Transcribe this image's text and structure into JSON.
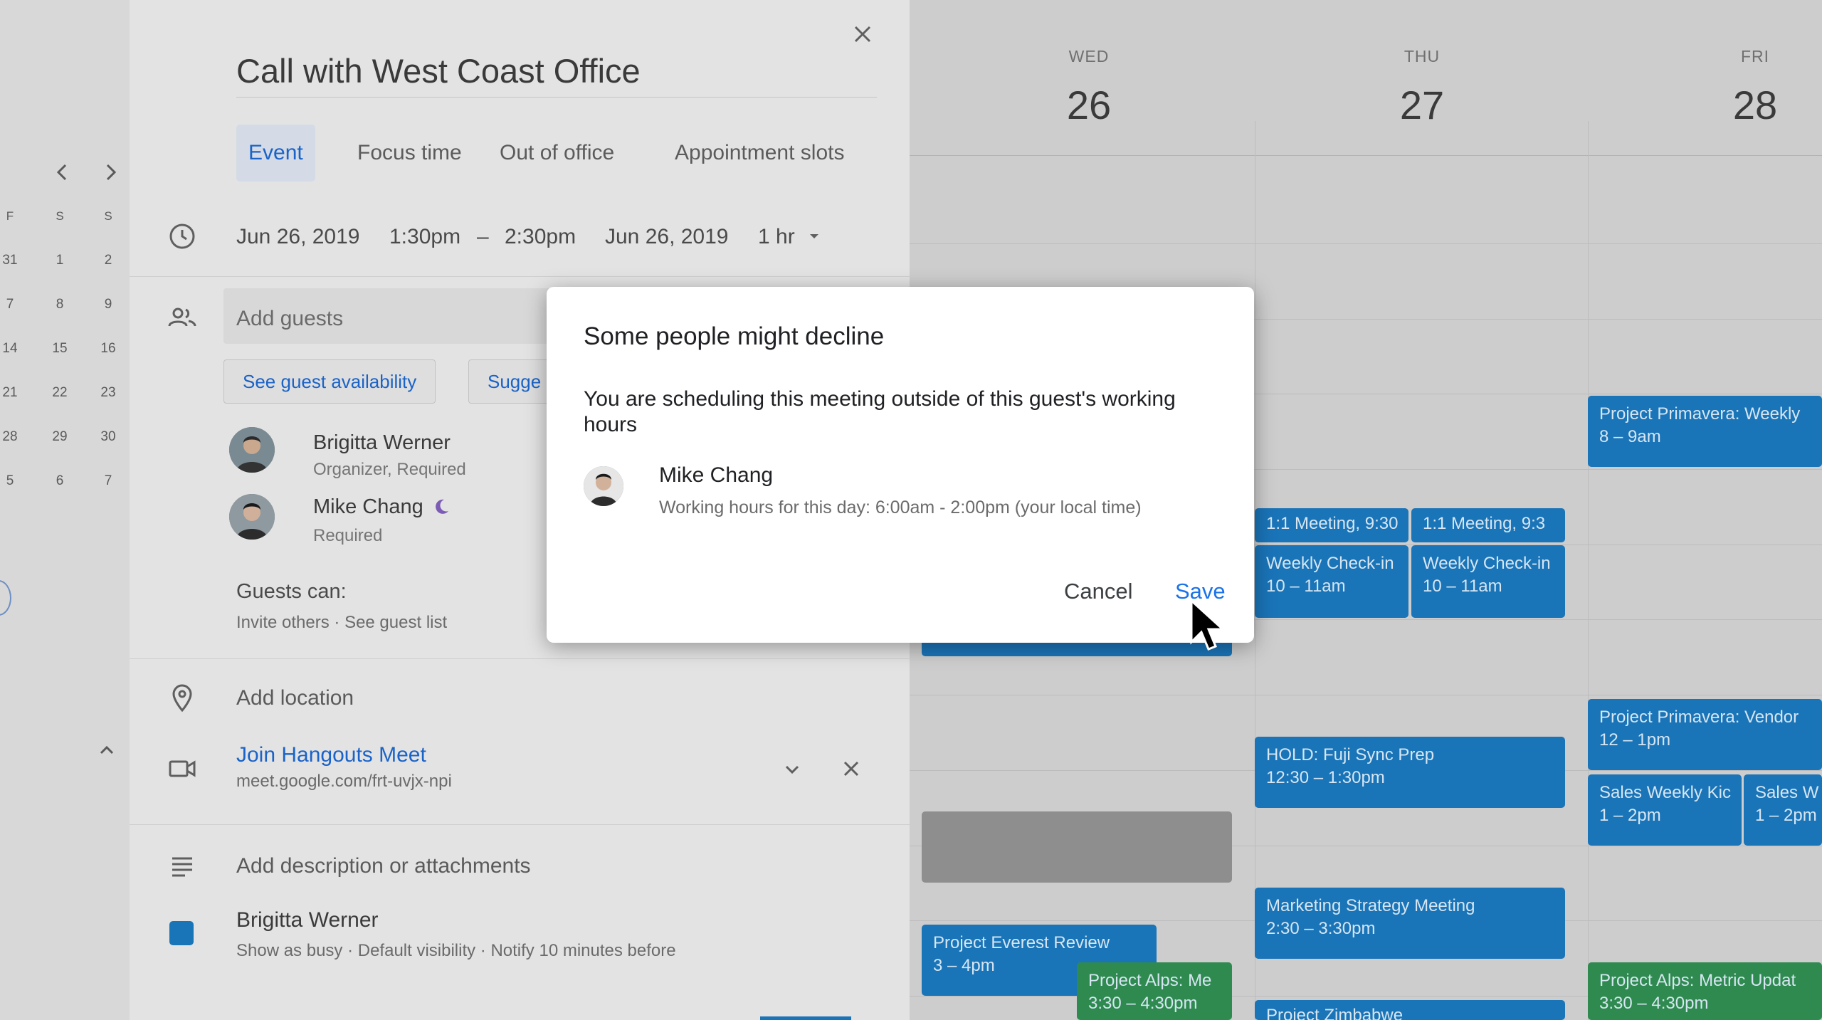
{
  "minical": {
    "weekday_headers": [
      "F",
      "S",
      "S"
    ],
    "rows": [
      [
        "31",
        "1",
        "2"
      ],
      [
        "7",
        "8",
        "9"
      ],
      [
        "14",
        "15",
        "16"
      ],
      [
        "21",
        "22",
        "23"
      ],
      [
        "28",
        "29",
        "30"
      ],
      [
        "5",
        "6",
        "7"
      ]
    ]
  },
  "editor": {
    "title": "Call with West Coast Office",
    "tabs": [
      "Event",
      "Focus time",
      "Out of office",
      "Appointment slots"
    ],
    "start_date": "Jun 26, 2019",
    "start_time": "1:30pm",
    "dash": "–",
    "end_time": "2:30pm",
    "end_date": "Jun 26, 2019",
    "duration": "1 hr",
    "guests_placeholder": "Add guests",
    "see_availability": "See guest availability",
    "suggest_partial": "Sugge",
    "guests": [
      {
        "name": "Brigitta Werner",
        "role": "Organizer, Required"
      },
      {
        "name": "Mike Chang",
        "role": "Required"
      }
    ],
    "guests_can_label": "Guests can:",
    "guests_can_value": "Invite others · See guest list",
    "location_placeholder": "Add location",
    "meet_title": "Join Hangouts Meet",
    "meet_link": "meet.google.com/frt-uvjx-npi",
    "description_placeholder": "Add description or attachments",
    "owner": "Brigitta Werner",
    "owner_meta": "Show as busy · Default visibility · Notify 10 minutes before"
  },
  "calendar": {
    "days": [
      {
        "dow": "WED",
        "date": "26"
      },
      {
        "dow": "THU",
        "date": "27"
      },
      {
        "dow": "FRI",
        "date": "28"
      }
    ],
    "events": [
      {
        "title": "Project Primavera: Weekly",
        "time": "8 – 9am",
        "color": "blue"
      },
      {
        "title": "1:1 Meeting, 9:30",
        "time": "",
        "color": "blue"
      },
      {
        "title": "1:1 Meeting, 9:3",
        "time": "",
        "color": "blue"
      },
      {
        "title": "Weekly Check-in",
        "time": "10 – 11am",
        "color": "blue"
      },
      {
        "title": "Weekly Check-in",
        "time": "10 – 11am",
        "color": "blue"
      },
      {
        "title": "Project Primavera: Vendor",
        "time": "12 – 1pm",
        "color": "blue"
      },
      {
        "title": "HOLD: Fuji Sync Prep",
        "time": "12:30 – 1:30pm",
        "color": "blue"
      },
      {
        "title": "Sales Weekly Kic",
        "time": "1 – 2pm",
        "color": "blue"
      },
      {
        "title": "Sales W",
        "time": "1 – 2pm",
        "color": "blue"
      },
      {
        "title": "Marketing Strategy Meeting",
        "time": "2:30 – 3:30pm",
        "color": "blue"
      },
      {
        "title": "Project Everest Review",
        "time": "3 – 4pm",
        "color": "blue"
      },
      {
        "title": "Project Alps: Me",
        "time": "3:30 – 4:30pm",
        "color": "green"
      },
      {
        "title": "Project Alps: Metric Updat",
        "time": "3:30 – 4:30pm",
        "color": "green"
      },
      {
        "title": "Project Zimbabwe",
        "time": "",
        "color": "blue"
      }
    ]
  },
  "dialog": {
    "title": "Some people might decline",
    "message": "You are scheduling this meeting outside of this guest's working hours",
    "guest_name": "Mike Chang",
    "guest_hours": "Working hours for this day: 6:00am - 2:00pm (your local time)",
    "cancel": "Cancel",
    "save": "Save"
  },
  "colors": {
    "accent": "#1a73e8",
    "event_blue": "#1a74b8",
    "event_green": "#2f8a4f",
    "overlay_gray": "#cdcdcd"
  }
}
